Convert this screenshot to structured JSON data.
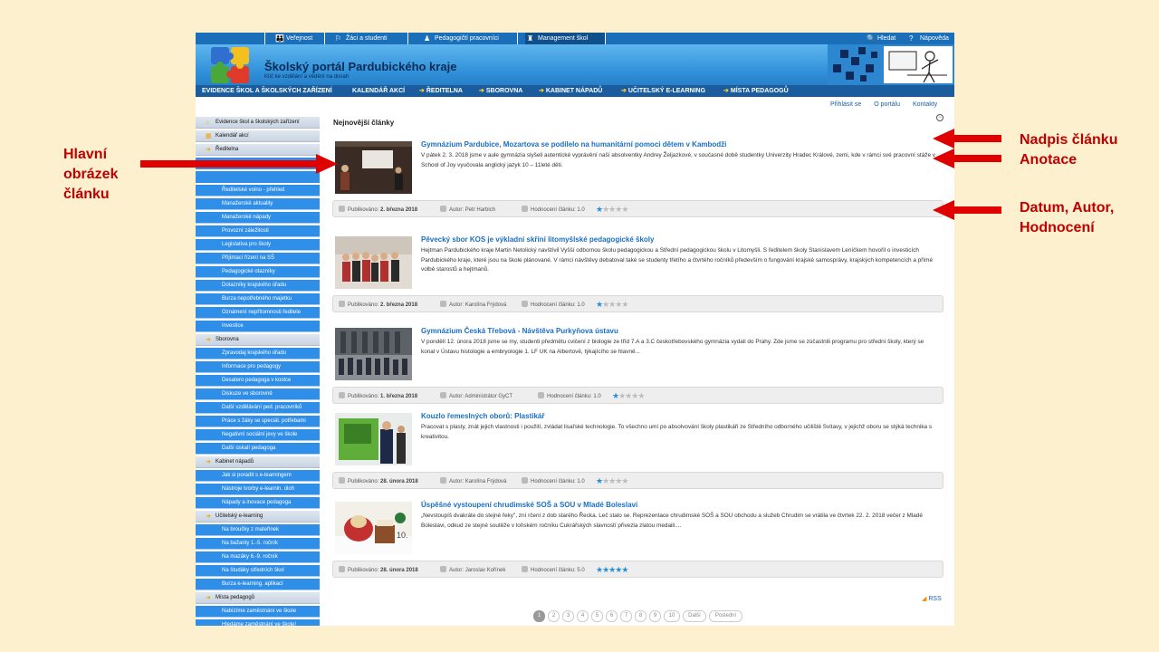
{
  "top_nav": {
    "items": [
      {
        "label": "Veřejnost",
        "icon": "family-icon"
      },
      {
        "label": "Žáci a studenti",
        "icon": "student-icon"
      },
      {
        "label": "Pedagogičtí pracovníci",
        "icon": "teacher-icon"
      },
      {
        "label": "Management škol",
        "icon": "manager-icon"
      }
    ],
    "search_label": "Hledat",
    "help_label": "Nápověda"
  },
  "header": {
    "title": "Školský portál Pardubického kraje",
    "subtitle": "Klíč ke vzdělání a vědění na dosah"
  },
  "main_menu": {
    "items": [
      "EVIDENCE ŠKOL A ŠKOLSKÝCH ZAŘÍZENÍ",
      "KALENDÁŘ AKCÍ",
      "ŘEDITELNA",
      "SBOROVNA",
      "KABINET NÁPADŮ",
      "UČITELSKÝ E-LEARNING",
      "MÍSTA PEDAGOGŮ"
    ]
  },
  "sidebar": {
    "items": [
      {
        "label": "Evidence škol a školských zařízení",
        "type": "top",
        "icon": "house-icon"
      },
      {
        "label": "Kalendář akcí",
        "type": "top",
        "icon": "calendar-icon"
      },
      {
        "label": "Ředitelna",
        "type": "top",
        "icon": "bullet-icon"
      },
      {
        "label": "",
        "type": "spacer"
      },
      {
        "label": "",
        "type": "spacer"
      },
      {
        "label": "Ředitelské volno - přehled",
        "type": "sub"
      },
      {
        "label": "Manažerské aktuality",
        "type": "sub"
      },
      {
        "label": "Manažerské nápady",
        "type": "sub"
      },
      {
        "label": "Provozní záležitosti",
        "type": "sub"
      },
      {
        "label": "Legislativa pro školy",
        "type": "sub"
      },
      {
        "label": "Přijímací řízení na SŠ",
        "type": "sub"
      },
      {
        "label": "Pedagogické otazníky",
        "type": "sub"
      },
      {
        "label": "Dotazníky krajského úřadu",
        "type": "sub"
      },
      {
        "label": "Burza nepotřebného majetku",
        "type": "sub"
      },
      {
        "label": "Oznámení nepřítomnosti ředitele",
        "type": "sub"
      },
      {
        "label": "Investice",
        "type": "sub"
      },
      {
        "label": "Sborovna",
        "type": "top",
        "icon": "bullet-icon"
      },
      {
        "label": "Zpravodaj krajského úřadu",
        "type": "sub"
      },
      {
        "label": "Informace pro pedagogy",
        "type": "sub"
      },
      {
        "label": "Desatero pedagoga v kostce",
        "type": "sub"
      },
      {
        "label": "Diskuze ve sborovně",
        "type": "sub"
      },
      {
        "label": "Další vzdělávání ped. pracovníků",
        "type": "sub"
      },
      {
        "label": "Práce s žáky se speciál. potřebami",
        "type": "sub"
      },
      {
        "label": "Negativní sociální jevy ve škole",
        "type": "sub"
      },
      {
        "label": "Další úskalí pedagoga",
        "type": "sub"
      },
      {
        "label": "Kabinet nápadů",
        "type": "top",
        "icon": "bullet-icon"
      },
      {
        "label": "Jak si poradit s e-learningem",
        "type": "sub"
      },
      {
        "label": "Nástroje tvorby e-learnin. úloh",
        "type": "sub"
      },
      {
        "label": "Nápady a inovace pedagoga",
        "type": "sub"
      },
      {
        "label": "Učitelský e-learning",
        "type": "top",
        "icon": "bullet-icon"
      },
      {
        "label": "Na broučky z mateřinek",
        "type": "sub"
      },
      {
        "label": "Na bažanty 1.-5. ročník",
        "type": "sub"
      },
      {
        "label": "Na mazáky 6.-9. ročník",
        "type": "sub"
      },
      {
        "label": "Na študáky středních škol",
        "type": "sub"
      },
      {
        "label": "Burza e-learning. aplikací",
        "type": "sub"
      },
      {
        "label": "Místa pedagogů",
        "type": "top",
        "icon": "bullet-icon"
      },
      {
        "label": "Nabízíme zaměstnání ve škole",
        "type": "sub"
      },
      {
        "label": "Hledáme zaměstnání ve škole!",
        "type": "sub"
      }
    ]
  },
  "links": {
    "login": "Přihlásit se",
    "about": "O portálu",
    "contacts": "Kontakty"
  },
  "section_title": "Nejnovější články",
  "articles": [
    {
      "title": "Gymnázium Pardubice, Mozartova se podílelo na humanitární pomoci dětem v Kambodži",
      "text": "V pátek 2. 3. 2018 jsme v aule gymnázia slyšeli autentické vyprávění naší absolventky Andrey Željazkové, v současné době studentky Univerzity Hradec Králové, zemi, kde v rámci své pracovní stáže v School of Joy vyučovala anglický jazyk 10 – 11leté děti.",
      "published_label": "Publikováno:",
      "date": "2. března 2018",
      "author_label": "Autor:",
      "author": "Petr Harbich",
      "rating_label": "Hodnocení článku:",
      "rating": "1.0",
      "rating_value": 1
    },
    {
      "title": "Pěvecký sbor KOS je výkladní skříní litomyšlské pedagogické školy",
      "text": "Hejtman Pardubického kraje Martin Netolický navštívil Vyšší odbornou školu pedagogickou a Střední pedagogickou školu v Litomyšli. S ředitelem školy Stanislavem Leníčkem hovořil o investicích Pardubického kraje, které jsou na škole plánované. V rámci návštěvy debatoval také se studenty třetího a čtvrtého ročníků především o fungování krajské samosprávy, krajských kompetencích a přímé volbě starostů a hejtmanů.",
      "published_label": "Publikováno:",
      "date": "2. března 2018",
      "author_label": "Autor:",
      "author": "Karolína Frýdová",
      "rating_label": "Hodnocení článku:",
      "rating": "1.0",
      "rating_value": 1
    },
    {
      "title": "Gymnázium Česká Třebová - Návštěva Purkyňova ústavu",
      "text": "V pondělí 12. února 2018 jsme se my, studenti předmětu cvičení z biologie ze tříd 7.A a 3.C českotřebovského gymnázia vydali do Prahy. Zde jsme se zúčastnili programu pro střední školy, který se konal v Ústavu histologie a embryologie 1. LF UK na Albertově, týkajícího se hlavně...",
      "published_label": "Publikováno:",
      "date": "1. března 2018",
      "author_label": "Autor:",
      "author": "Administrátor GyCT",
      "rating_label": "Hodnocení článku:",
      "rating": "1.0",
      "rating_value": 1
    },
    {
      "title": "Kouzlo řemeslných oborů: Plastikář",
      "text": "Pracovat s plasty, znát jejich vlastnosti i použití, zvládat lisařské technologie. To všechno umí po absolvování školy plastikáři ze Středního odborného učiliště Svitavy, v jejichž oboru se stýká technika s kreativitou.",
      "published_label": "Publikováno:",
      "date": "28. února 2018",
      "author_label": "Autor:",
      "author": "Karolína Frýdová",
      "rating_label": "Hodnocení článku:",
      "rating": "1.0",
      "rating_value": 1
    },
    {
      "title": "Úspěšné vystoupení chrudimské SOŠ a SOU v Mladé Boleslavi",
      "text": "„Nevstoupíš dvakráte do stejné řeky\", zní rčení z dob starého Řecka. Leč stalo se. Reprezentace chrudimské SOŠ a SOU obchodu a služeb Chrudim se vrátila ve čtvrtek 22. 2. 2018 večer z Mladé Boleslavi, odkud ze stejné soutěže v loňském ročníku Cukrářských slavností přivezla zlatou medaili....",
      "published_label": "Publikováno:",
      "date": "28. února 2018",
      "author_label": "Autor:",
      "author": "Jaroslav Kořínek",
      "rating_label": "Hodnocení článku:",
      "rating": "5.0",
      "rating_value": 5
    }
  ],
  "rss_label": "RSS",
  "pager": {
    "pages": [
      "1",
      "2",
      "3",
      "4",
      "5",
      "6",
      "7",
      "8",
      "9",
      "10"
    ],
    "current": "1",
    "next_label": "Další",
    "last_label": "Poslední"
  },
  "annotations": {
    "main_image": "Hlavní obrázek článku",
    "heading": "Nadpis článku",
    "annotation": "Anotace",
    "meta": "Datum, Autor, Hodnocení"
  },
  "colors": {
    "annotation": "#c00000",
    "link": "#1a6fc0",
    "menu": "#1a5c9e",
    "background": "#fdf0cf"
  }
}
